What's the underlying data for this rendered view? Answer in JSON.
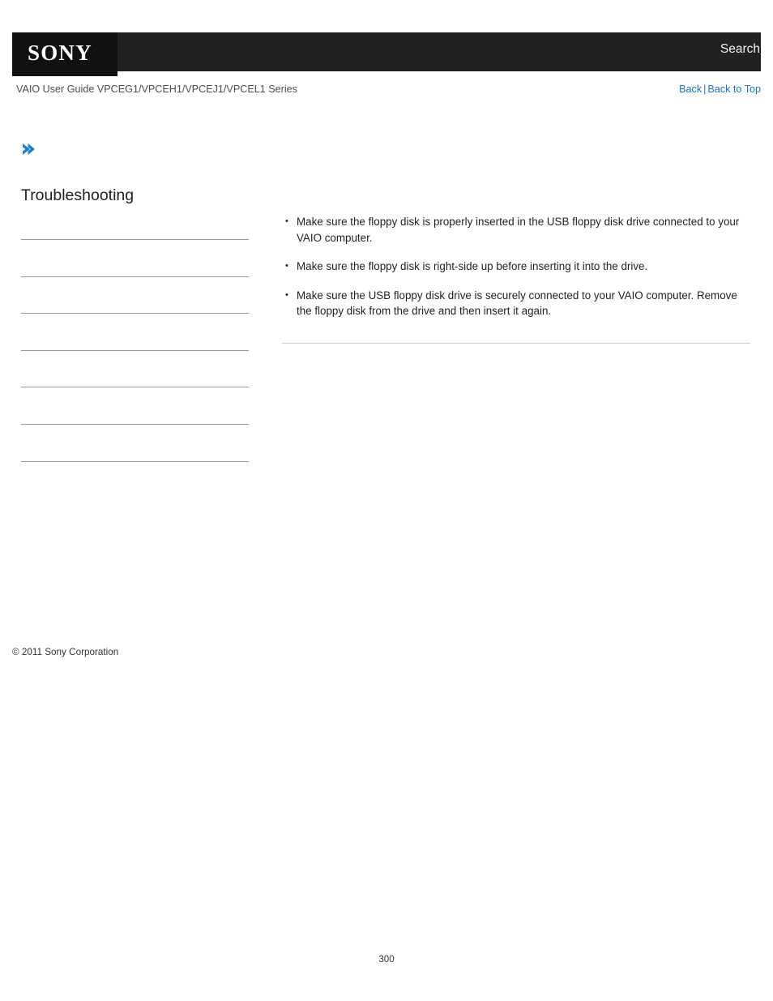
{
  "header": {
    "logo_text": "SONY",
    "search_label": "Search",
    "background_color": "#212121",
    "logo_block_color": "#111111"
  },
  "subheader": {
    "guide_title": "VAIO User Guide VPCEG1/VPCEH1/VPCEJ1/VPCEL1 Series",
    "back_label": "Back",
    "separator": "|",
    "back_to_top_label": "Back to Top",
    "link_color": "#1a72c4"
  },
  "sidebar": {
    "title": "Troubleshooting",
    "items": [
      {
        "label": ""
      },
      {
        "label": ""
      },
      {
        "label": ""
      },
      {
        "label": ""
      },
      {
        "label": ""
      },
      {
        "label": ""
      },
      {
        "label": ""
      }
    ],
    "copyright": "© 2011 Sony Corporation"
  },
  "main": {
    "bullets": [
      "Make sure the floppy disk is properly inserted in the USB floppy disk drive connected to your VAIO computer.",
      "Make sure the floppy disk is right-side up before inserting it into the drive.",
      "Make sure the USB floppy disk drive is securely connected to your VAIO computer. Remove the floppy disk from the drive and then insert it again."
    ]
  },
  "footer": {
    "page_number": "300"
  },
  "icons": {
    "arrow_icon_color": "#1f7fc4"
  }
}
